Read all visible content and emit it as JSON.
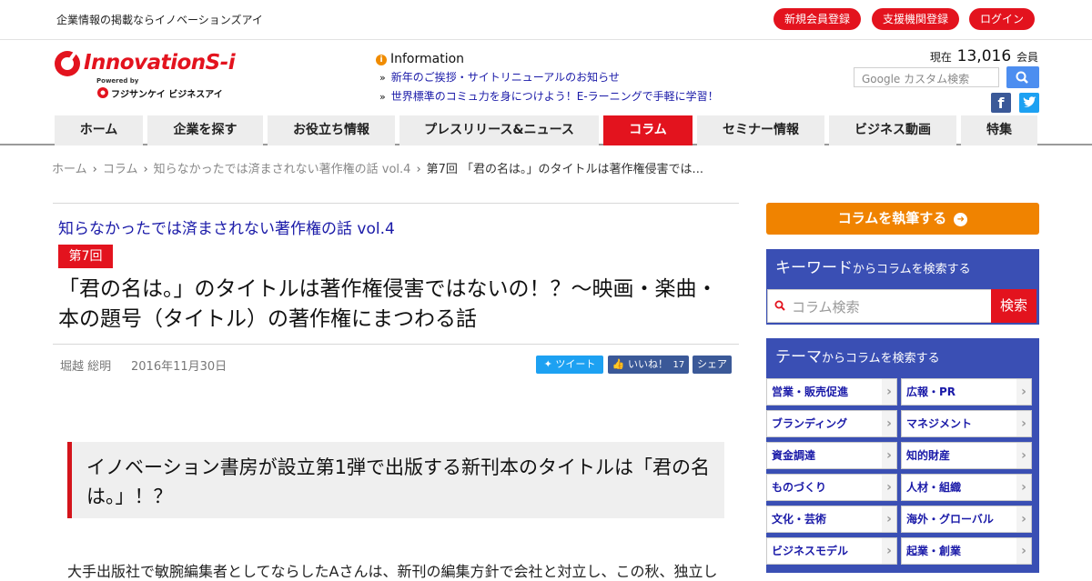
{
  "topbar": {
    "tagline": "企業情報の掲載ならイノベーションズアイ",
    "buttons": [
      "新規会員登録",
      "支援機関登録",
      "ログイン"
    ]
  },
  "logo": {
    "name": "InnovationS-i",
    "powered": "Powered by",
    "sub": "フジサンケイ ビジネスアイ"
  },
  "info": {
    "heading": "Information",
    "items": [
      "新年のご挨拶・サイトリニューアルのお知らせ",
      "世界標準のコミュ力を身につけよう！E-ラーニングで手軽に学習！"
    ]
  },
  "members": {
    "prefix": "現在",
    "count": "13,016",
    "suffix": "会員"
  },
  "search": {
    "placeholder": "Google カスタム検索"
  },
  "social": {
    "facebook": "f",
    "twitter": "t"
  },
  "nav": [
    "ホーム",
    "企業を探す",
    "お役立ち情報",
    "プレスリリース&ニュース",
    "コラム",
    "セミナー情報",
    "ビジネス動画",
    "特集"
  ],
  "breadcrumb": [
    "ホーム",
    "コラム",
    "知らなかったでは済まされない著作権の話 vol.4",
    "第7回 「君の名は。」のタイトルは著作権侵害では..."
  ],
  "article": {
    "series": "知らなかったでは済まされない著作権の話 vol.4",
    "badge": "第7回",
    "title": "「君の名は。」のタイトルは著作権侵害ではないの！？～映画・楽曲・本の題号（タイトル）の著作権にまつわる話",
    "author": "堀越 総明",
    "date": "2016年11月30日",
    "share": {
      "tweet": "ツイート",
      "like": "いいね！",
      "like_count": "17",
      "share": "シェア"
    },
    "lead": "イノベーション書房が設立第1弾で出版する新刊本のタイトルは「君の名は。」！？",
    "body": "大手出版社で敏腕編集者としてならしたAさんは、新刊の編集方針で会社と対立し、この秋、独立し"
  },
  "sidebar": {
    "write_button": "コラムを執筆する",
    "keyword": {
      "big": "キーワード",
      "small": "からコラムを検索する",
      "placeholder": "コラム検索",
      "button": "検索"
    },
    "theme": {
      "big": "テーマ",
      "small": "からコラムを検索する"
    },
    "themes": [
      "営業・販売促進",
      "広報・PR",
      "ブランディング",
      "マネジメント",
      "資金調達",
      "知的財産",
      "ものづくり",
      "人材・組織",
      "文化・芸術",
      "海外・グローバル",
      "ビジネスモデル",
      "起業・創業"
    ]
  },
  "colors": {
    "accent_red": "#e3131e",
    "navy": "#3a4fb4",
    "orange": "#f08300",
    "link_blue": "#1a1aa8"
  }
}
